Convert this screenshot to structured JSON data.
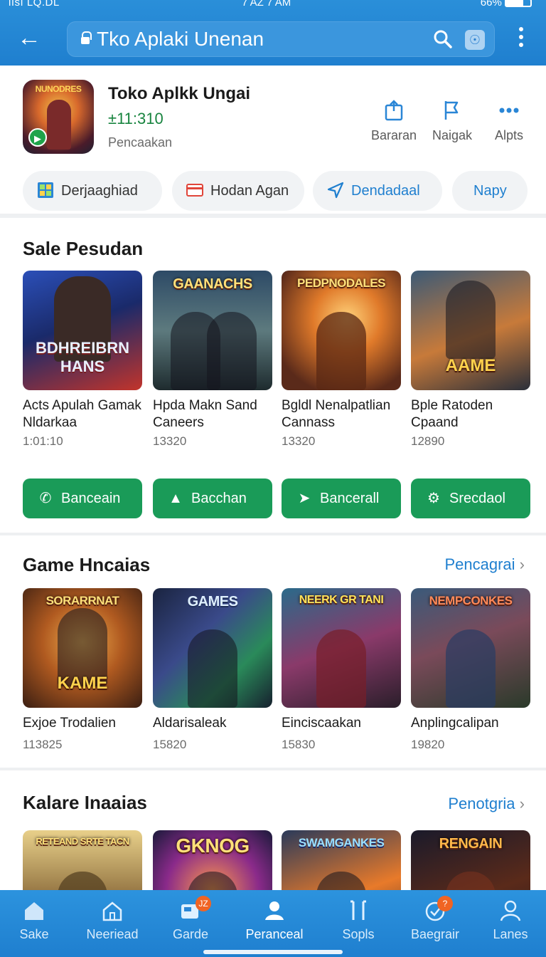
{
  "status": {
    "left": "lısı LQ.DL",
    "center": "7 AZ 7 AM",
    "right": "66%"
  },
  "search": {
    "query": "Tko Aplaki Unenan"
  },
  "app": {
    "name": "Toko Aplkk Ungai",
    "price": "±11:310",
    "subtitle": "Pencaakan",
    "icon_title": "NUNODRES",
    "actions": [
      {
        "label": "Bararan",
        "icon": "share-icon"
      },
      {
        "label": "Naigak",
        "icon": "flag-icon"
      },
      {
        "label": "Alpts",
        "icon": "more-dots-icon"
      }
    ],
    "chips": [
      {
        "label": "Derjaaghiad",
        "icon": "grid-icon"
      },
      {
        "label": "Hodan Agan",
        "icon": "card-icon"
      },
      {
        "label": "Dendadaal",
        "icon": "send-icon"
      },
      {
        "label": "Napy",
        "icon": ""
      }
    ]
  },
  "sections": [
    {
      "title": "Sale Pesudan",
      "link": "",
      "items": [
        {
          "name": "Acts Apulah Gamak Nldarkaa",
          "count": "1:01:10",
          "art_top": "",
          "art_bottom": "BDHREIBRN HANS"
        },
        {
          "name": "Hpda Makn Sand Caneers",
          "count": "13320",
          "art_top": "GAANACHS",
          "art_bottom": ""
        },
        {
          "name": "Bgldl Nenalpatlian Cannass",
          "count": "13320",
          "art_top": "PEDPNODALES",
          "art_bottom": ""
        },
        {
          "name": "Bple Ratoden Cpaand",
          "count": "12890",
          "art_top": "",
          "art_bottom": "AAME"
        }
      ],
      "buttons": [
        {
          "label": "Banceain",
          "icon": "phone-icon"
        },
        {
          "label": "Bacchan",
          "icon": "thumbs-up-icon"
        },
        {
          "label": "Bancerall",
          "icon": "bird-icon"
        },
        {
          "label": "Srecdaol",
          "icon": "gear-icon"
        }
      ]
    },
    {
      "title": "Game Hncaias",
      "link": "Pencagrai",
      "items": [
        {
          "name": "Exjoe Trodalien",
          "count": "113825",
          "art_top": "SORARRNAT",
          "art_bottom": "KAME"
        },
        {
          "name": "Aldarisaleak",
          "count": "15820",
          "art_top": "GAMES",
          "art_bottom": ""
        },
        {
          "name": "Einciscaakan",
          "count": "15830",
          "art_top": "NEERK GR TANI",
          "art_bottom": ""
        },
        {
          "name": "Anplingcalipan",
          "count": "19820",
          "art_top": "NEMPCONKES",
          "art_bottom": ""
        }
      ]
    },
    {
      "title": "Kalare Inaaias",
      "link": "Penotgria",
      "items": [
        {
          "art_top": "RETEAND SRTE TACN"
        },
        {
          "art_top": "GKNOG"
        },
        {
          "art_top": "SWAMGANKES"
        },
        {
          "art_top": "RENGAIN"
        }
      ]
    }
  ],
  "nav": [
    {
      "label": "Sake",
      "icon": "home-icon",
      "badge": ""
    },
    {
      "label": "Neeriead",
      "icon": "house-outline-icon",
      "badge": ""
    },
    {
      "label": "Garde",
      "icon": "cards-icon",
      "badge": "JZ"
    },
    {
      "label": "Peranceal",
      "icon": "person-icon",
      "badge": ""
    },
    {
      "label": "Sopls",
      "icon": "bracket-icon",
      "badge": ""
    },
    {
      "label": "Baegrair",
      "icon": "heart-check-icon",
      "badge": "?"
    },
    {
      "label": "Lanes",
      "icon": "user-outline-icon",
      "badge": ""
    }
  ]
}
